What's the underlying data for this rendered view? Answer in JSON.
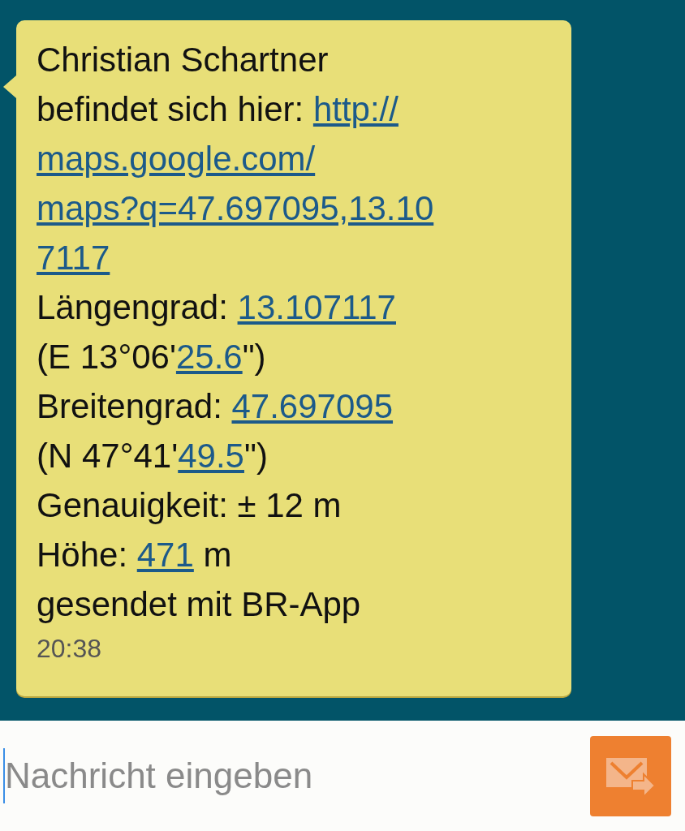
{
  "message": {
    "lines": [
      [
        {
          "text": "Christian Schartner",
          "link": false
        }
      ],
      [
        {
          "text": "befindet sich hier: ",
          "link": false
        },
        {
          "text": "http://",
          "link": true
        }
      ],
      [
        {
          "text": "maps.google.com/",
          "link": true
        }
      ],
      [
        {
          "text": "maps?q=47.697095,13.10",
          "link": true
        }
      ],
      [
        {
          "text": "7117",
          "link": true
        }
      ],
      [
        {
          "text": "Längengrad: ",
          "link": false
        },
        {
          "text": "13.107117",
          "link": true
        }
      ],
      [
        {
          "text": "(E 13°06'",
          "link": false
        },
        {
          "text": "25.6",
          "link": true
        },
        {
          "text": "\")",
          "link": false
        }
      ],
      [
        {
          "text": "Breitengrad: ",
          "link": false
        },
        {
          "text": "47.697095",
          "link": true
        }
      ],
      [
        {
          "text": "(N 47°41'",
          "link": false
        },
        {
          "text": "49.5",
          "link": true
        },
        {
          "text": "\")",
          "link": false
        }
      ],
      [
        {
          "text": "Genauigkeit: ± 12 m",
          "link": false
        }
      ],
      [
        {
          "text": "Höhe: ",
          "link": false
        },
        {
          "text": "471",
          "link": true
        },
        {
          "text": " m",
          "link": false
        }
      ],
      [
        {
          "text": "gesendet mit BR-App",
          "link": false
        }
      ]
    ],
    "time": "20:38"
  },
  "composer": {
    "placeholder": "Nachricht eingeben"
  }
}
